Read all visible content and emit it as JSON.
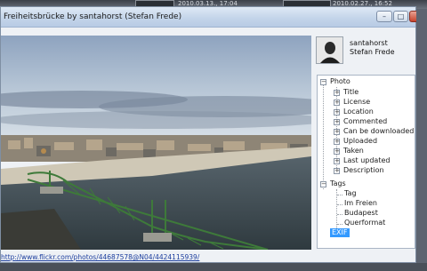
{
  "background": {
    "dates": [
      "2010.03.13., 17:04",
      "2010.02.27., 16:52"
    ]
  },
  "window": {
    "title": "Freiheitsbrücke by santahorst (Stefan Frede)",
    "controls": {
      "minimize": "–",
      "maximize": "□",
      "close": ""
    }
  },
  "user": {
    "username": "santahorst",
    "realname": "Stefan Frede"
  },
  "tree": {
    "photo_label": "Photo",
    "photo_children": [
      "Title",
      "License",
      "Location",
      "Commented",
      "Can be downloaded",
      "Uploaded",
      "Taken",
      "Last updated",
      "Description"
    ],
    "tags_label": "Tags",
    "tags_children": [
      "Tag",
      "Im Freien",
      "Budapest",
      "Querformat"
    ],
    "exif_label": "EXIF"
  },
  "link": {
    "url": "http://www.flickr.com/photos/44687578@N04/4424115939/"
  },
  "colors": {
    "selected": "#3399ff",
    "link": "#1c3e9e",
    "bridge": "#3e7a3a"
  }
}
